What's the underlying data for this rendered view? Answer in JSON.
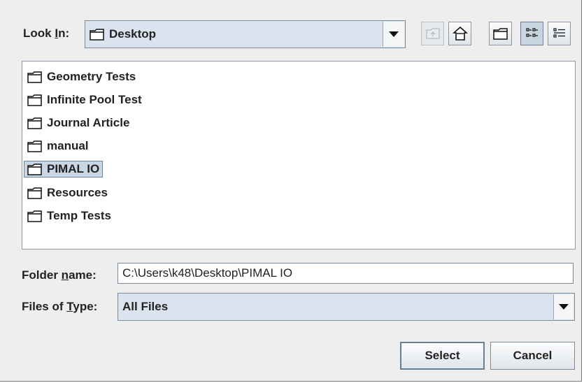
{
  "look_in": {
    "label_pre": "Look ",
    "label_key": "I",
    "label_post": "n:",
    "value": "Desktop"
  },
  "toolbar": {
    "icons": [
      "up-one-level-icon",
      "home-icon",
      "new-folder-icon",
      "list-view-icon",
      "details-view-icon"
    ]
  },
  "files": {
    "items": [
      {
        "name": "Geometry Tests"
      },
      {
        "name": "Infinite Pool Test"
      },
      {
        "name": "Journal Article"
      },
      {
        "name": "manual"
      },
      {
        "name": "PIMAL IO",
        "selected": true
      },
      {
        "name": "Resources"
      },
      {
        "name": "Temp Tests"
      }
    ]
  },
  "folder_name": {
    "label_pre": "Folder ",
    "label_key": "n",
    "label_post": "ame:",
    "value": "C:\\Users\\k48\\Desktop\\PIMAL IO"
  },
  "files_of_type": {
    "label_pre": "Files of ",
    "label_key": "T",
    "label_post": "ype:",
    "value": "All Files"
  },
  "buttons": {
    "select": "Select",
    "cancel": "Cancel"
  },
  "colors": {
    "selection": "#c9d6e3",
    "dialog_bg": "#eeeeee",
    "combo_bg": "#dbe4ee"
  }
}
